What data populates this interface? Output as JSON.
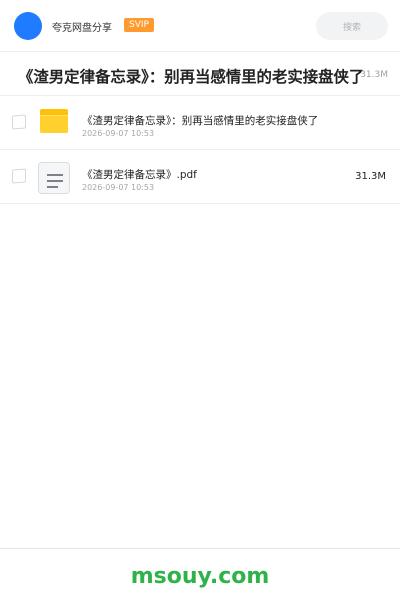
{
  "header": {
    "app_name": "夸克网盘分享",
    "badge": "SVIP",
    "search_placeholder": "搜索",
    "avatar_color": "#1f7bff",
    "badge_color": "#ff9a2e"
  },
  "folder": {
    "title": "《渣男定律备忘录》：别再当感情里的老实接盘侠了",
    "size": "31.3M"
  },
  "files": [
    {
      "icon": "folder-icon",
      "name": "《渣男定律备忘录》：别再当感情里的老实接盘侠了",
      "date": "2026-09-07 10:53",
      "size": ""
    },
    {
      "icon": "document-icon",
      "name": "《渣男定律备忘录》.pdf",
      "date": "2026-09-07 10:53",
      "size": "31.3M"
    }
  ],
  "footer": {
    "watermark": "msouy.com",
    "watermark_color": "#2fb24a"
  }
}
